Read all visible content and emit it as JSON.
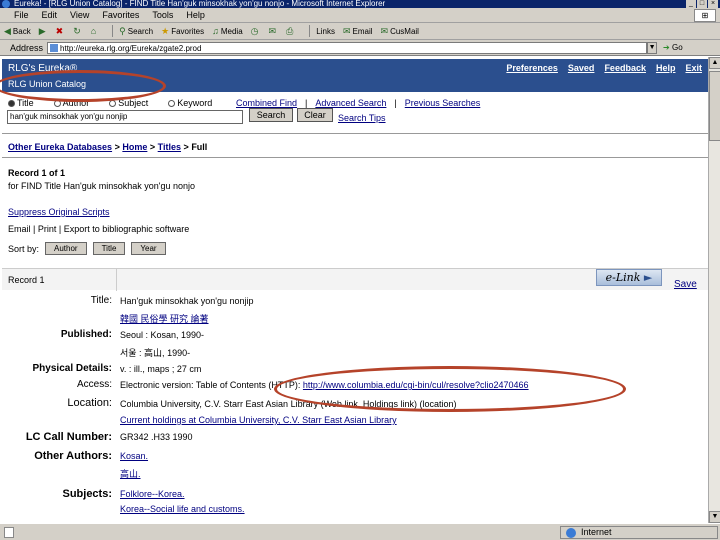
{
  "window": {
    "title": "Eureka! - [RLG Union Catalog] - FIND Title Han'guk minsokhak yon'gu nonjo - Microsoft Internet Explorer",
    "buttons": [
      "_",
      "□",
      "×"
    ]
  },
  "menubar": {
    "items": [
      "File",
      "Edit",
      "View",
      "Favorites",
      "Tools",
      "Help"
    ]
  },
  "toolbar": {
    "back_label": "Back",
    "search_label": "Search",
    "favorites_label": "Favorites",
    "media_label": "Media",
    "links_label": "Links",
    "email_label": "Email",
    "cusmail_label": "CusMail"
  },
  "addressbar": {
    "label": "Address",
    "url": "http://eureka.rlg.org/Eureka/zgate2.prod",
    "go_label": "Go"
  },
  "header": {
    "brand": "RLG's Eureka®",
    "database": "RLG Union Catalog",
    "links": [
      "Preferences",
      "Saved",
      "Feedback",
      "Help",
      "Exit"
    ]
  },
  "search": {
    "types": [
      "Title",
      "Author",
      "Subject",
      "Keyword"
    ],
    "selected_type": "Title",
    "aux_links": [
      "Combined Find",
      "Advanced Search",
      "Previous Searches"
    ],
    "query": "han'guk minsokhak yon'gu nonjip",
    "search_button": "Search",
    "clear_button": "Clear",
    "tips_link": "Search Tips"
  },
  "breadcrumb": {
    "items": [
      "Other Eureka Databases",
      "Home",
      "Titles"
    ],
    "current": "Full",
    "separator": ">"
  },
  "record_info": {
    "line1": "Record 1 of 1",
    "line2": "for FIND Title Han'guk minsokhak yon'gu nonjo"
  },
  "actions": {
    "suppress": "Suppress Original Scripts",
    "email_row": "Email | Print | Export to bibliographic software",
    "sort_label": "Sort by:",
    "sort_buttons": [
      "Author",
      "Title",
      "Year"
    ]
  },
  "record": {
    "label": "Record 1",
    "elink": "e-Link",
    "save": "Save",
    "fields": {
      "title_label": "Title:",
      "title_value": "Han'guk minsokhak yon'gu nonjip",
      "title_vernacular": "韓國 民俗學 研究 論著",
      "published_label": "Published:",
      "published_value": "Seoul : Kosan, 1990-",
      "published_vernacular": "서울 : 高山, 1990-",
      "physical_label": "Physical Details:",
      "physical_value": "v. : ill., maps ; 27 cm",
      "access_label": "Access:",
      "access_value": "Electronic version: Table of Contents (HTTP):",
      "access_url": "http://www.columbia.edu/cgi-bin/cul/resolve?clio2470466",
      "location_label": "Location:",
      "location_value": "Columbia University, C.V. Starr East Asian Library (Web link, Holdings link) (location)",
      "location_value2": "Current holdings at Columbia University, C.V. Starr East Asian Library",
      "lc_label": "LC Call Number:",
      "lc_value": "GR342 .H33 1990",
      "other_authors_label": "Other Authors:",
      "other_authors_value": "Kosan.",
      "other_authors_vernacular": "高山.",
      "subjects_label": "Subjects:",
      "subject1": "Folklore--Korea.",
      "subject2": "Korea--Social life and customs."
    }
  },
  "statusbar": {
    "zone": "Internet"
  }
}
